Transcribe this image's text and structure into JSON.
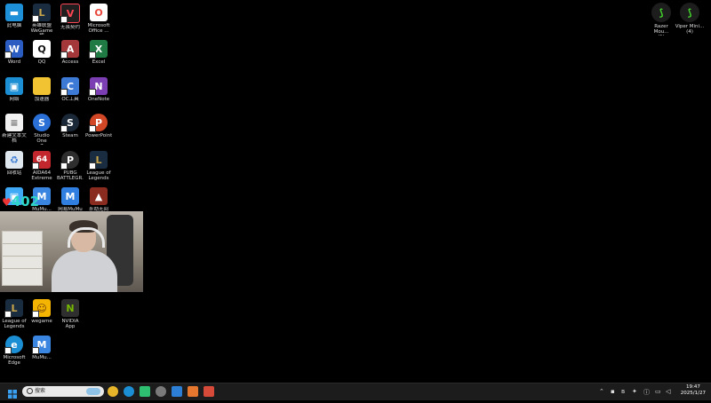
{
  "desktop": {
    "icons": [
      {
        "label": "此电脑",
        "glyph": "▬",
        "bg": "#1e90d8"
      },
      {
        "label": "英雄联盟\nWeGame版",
        "glyph": "L",
        "bg": "#1a2c3f"
      },
      {
        "label": "无畏契约",
        "glyph": "V",
        "bg": "#1f1f1f"
      },
      {
        "label": "Microsoft\nOffice ...",
        "glyph": "O",
        "bg": "#e8473c"
      },
      {
        "label": "Word",
        "glyph": "W",
        "bg": "#2b5cc2"
      },
      {
        "label": "QQ",
        "glyph": "Q",
        "bg": "#ffffff"
      },
      {
        "label": "Access",
        "glyph": "A",
        "bg": "#a4373a"
      },
      {
        "label": "Excel",
        "glyph": "X",
        "bg": "#1f7a44"
      },
      {
        "label": "网络",
        "glyph": "▣",
        "bg": "#1c8fd4"
      },
      {
        "label": "加速器",
        "glyph": "■",
        "bg": "#f1c232"
      },
      {
        "label": "OC工具",
        "glyph": "C",
        "bg": "#3d7ad6"
      },
      {
        "label": "OneNote",
        "glyph": "N",
        "bg": "#7b3fb3"
      },
      {
        "label": "新建文本文档",
        "glyph": "≡",
        "bg": "#f2f2f2"
      },
      {
        "label": "Studio One\n7",
        "glyph": "S",
        "bg": "#2a6fd6"
      },
      {
        "label": "Steam",
        "glyph": "S",
        "bg": "#1b2838"
      },
      {
        "label": "PowerPoint",
        "glyph": "P",
        "bg": "#d24726"
      },
      {
        "label": "回收站",
        "glyph": "♻",
        "bg": "#dfe7ef"
      },
      {
        "label": "AIDA64\nExtreme",
        "glyph": "64",
        "bg": "#c1272d"
      },
      {
        "label": "PUBG\nBATTLEGR...",
        "glyph": "P",
        "bg": "#2e2e2e"
      },
      {
        "label": "League of\nLegends",
        "glyph": "L",
        "bg": "#1a2c3f"
      },
      {
        "label": "英雄联盟",
        "glyph": "▣",
        "bg": "#3fa9f5"
      },
      {
        "label": "MuMu...",
        "glyph": "M",
        "bg": "#3a85e0"
      },
      {
        "label": "网易MuMu",
        "glyph": "M",
        "bg": "#2f7ee0"
      },
      {
        "label": "永劫无间",
        "glyph": "▲",
        "bg": "#8a2b1f"
      },
      {
        "label": "League of\nLegends",
        "glyph": "L",
        "bg": "#1a2c3f"
      },
      {
        "label": "wegame",
        "glyph": "☺",
        "bg": "#f4b400"
      },
      {
        "label": "NVIDIA App",
        "glyph": "N",
        "bg": "#2f2f2f"
      },
      {
        "label": "Microsoft\nEdge",
        "glyph": "e",
        "bg": "#1c8fd4"
      },
      {
        "label": "MuMu...",
        "glyph": "M",
        "bg": "#3a85e0"
      }
    ],
    "razer_icons": [
      {
        "label": "Razer Mou...\n(1)"
      },
      {
        "label": "Viper Mini...\n(4)"
      }
    ],
    "hearts_badge": "402"
  },
  "taskbar": {
    "search_placeholder": "搜索",
    "apps": [
      {
        "name": "chrome",
        "color": "#e7b52a"
      },
      {
        "name": "edge",
        "color": "#1c8fd4"
      },
      {
        "name": "notes",
        "color": "#2fbf71"
      },
      {
        "name": "obs",
        "color": "#7a7a7a"
      },
      {
        "name": "store",
        "color": "#2d7fd6"
      },
      {
        "name": "app-orange",
        "color": "#e6772e"
      },
      {
        "name": "app-red",
        "color": "#d64a3a"
      }
    ],
    "clock_time": "19:47",
    "clock_date": "2025/1/27"
  }
}
